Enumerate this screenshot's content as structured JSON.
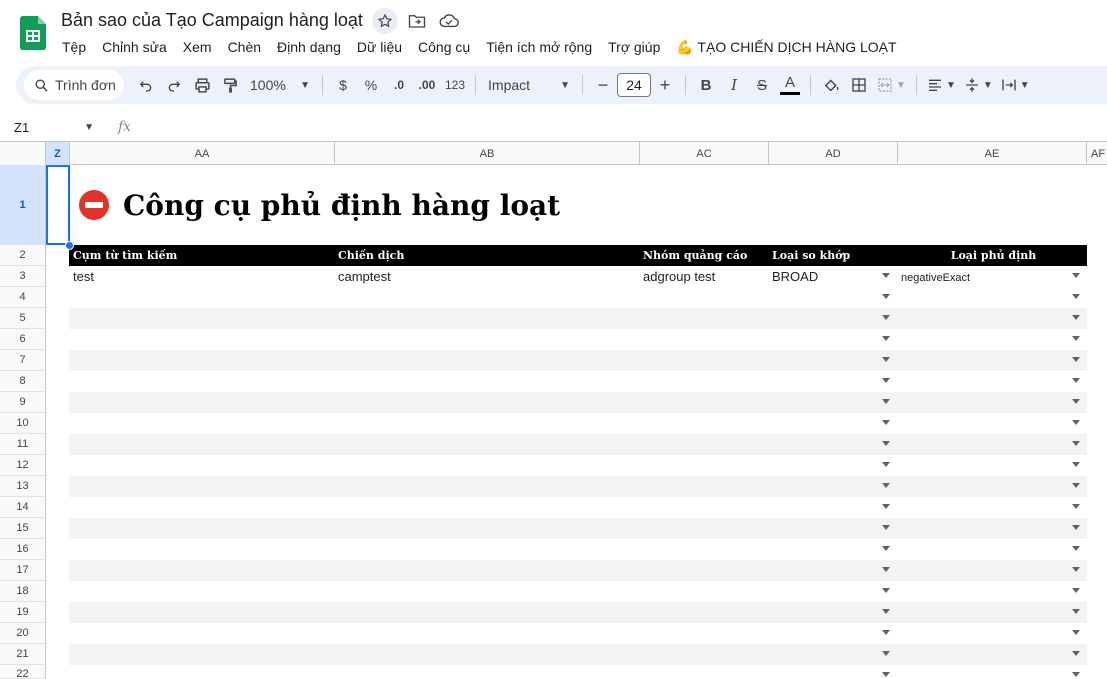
{
  "doc": {
    "title": "Bản sao của Tạo Campaign hàng loạt"
  },
  "menu": [
    "Tệp",
    "Chỉnh sửa",
    "Xem",
    "Chèn",
    "Định dạng",
    "Dữ liệu",
    "Công cụ",
    "Tiện ích mở rộng",
    "Trợ giúp",
    "💪 TẠO CHIẾN DỊCH HÀNG LOẠT"
  ],
  "toolbar": {
    "search_label": "Trình đơn",
    "zoom": "100%",
    "currency": "$",
    "percent": "%",
    "dec_decrease": ".0",
    "dec_increase": ".00",
    "number_format": "123",
    "font": "Impact",
    "font_size": "24",
    "minus": "−",
    "plus": "+",
    "bold": "B",
    "italic": "I",
    "strike": "S",
    "textcolor": "A"
  },
  "formula": {
    "namebox": "Z1",
    "fx": "fx"
  },
  "columns": [
    "Z",
    "AA",
    "AB",
    "AC",
    "AD",
    "AE",
    "AF"
  ],
  "rows": [
    "1",
    "2",
    "3",
    "4",
    "5",
    "6",
    "7",
    "8",
    "9",
    "10",
    "11",
    "12",
    "13",
    "14",
    "15",
    "16",
    "17",
    "18",
    "19",
    "20",
    "21",
    "22"
  ],
  "sheet": {
    "title": "Công cụ phủ định hàng loạt",
    "headers": [
      "Cụm từ tìm kiếm",
      "Chiến dịch",
      "Nhóm quảng cáo",
      "Loại so khớp",
      "Loại phủ định"
    ],
    "data_row": [
      "test",
      "camptest",
      "adgroup test",
      "BROAD",
      "negativeExact"
    ]
  }
}
